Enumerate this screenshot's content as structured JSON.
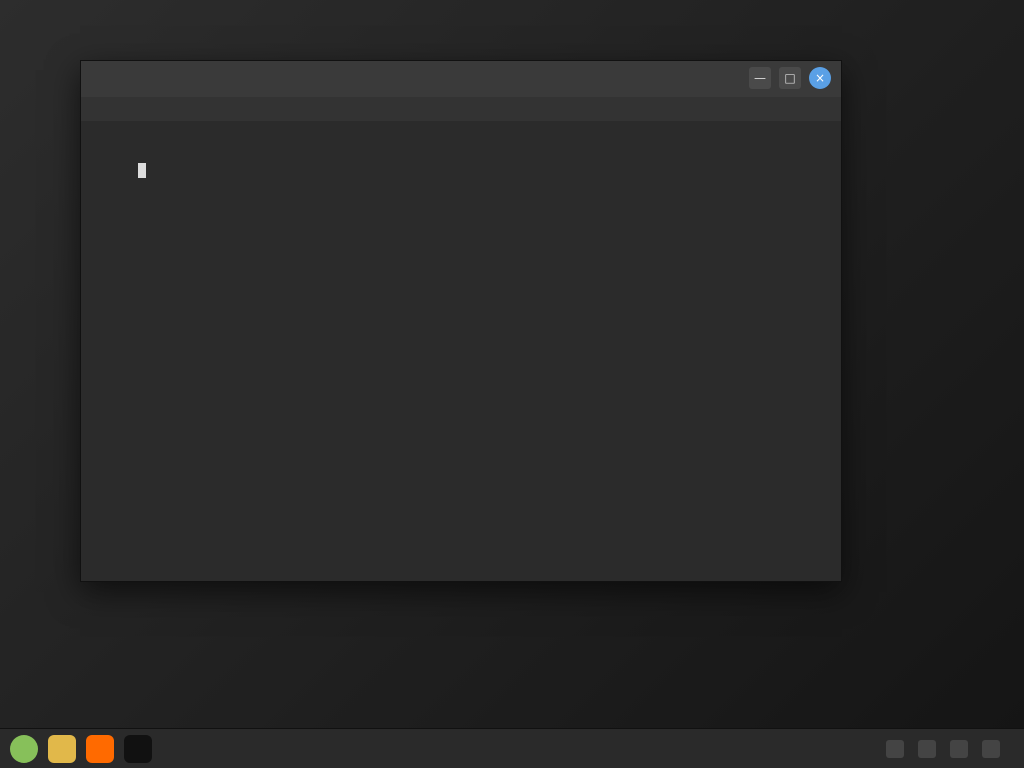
{
  "window": {
    "title": "",
    "controls": {
      "minimize": "—",
      "maximize": "□",
      "close": "×"
    }
  },
  "menubar": {
    "items": []
  },
  "terminal": {
    "lines": [],
    "prompt": {
      "user": "",
      "path": "",
      "symbol": ""
    }
  },
  "taskbar": {
    "launchers": [
      {
        "name": "menu",
        "label": ""
      },
      {
        "name": "files",
        "label": ""
      },
      {
        "name": "browser",
        "label": ""
      },
      {
        "name": "terminal",
        "label": ""
      }
    ],
    "tray": {
      "time": ""
    }
  }
}
